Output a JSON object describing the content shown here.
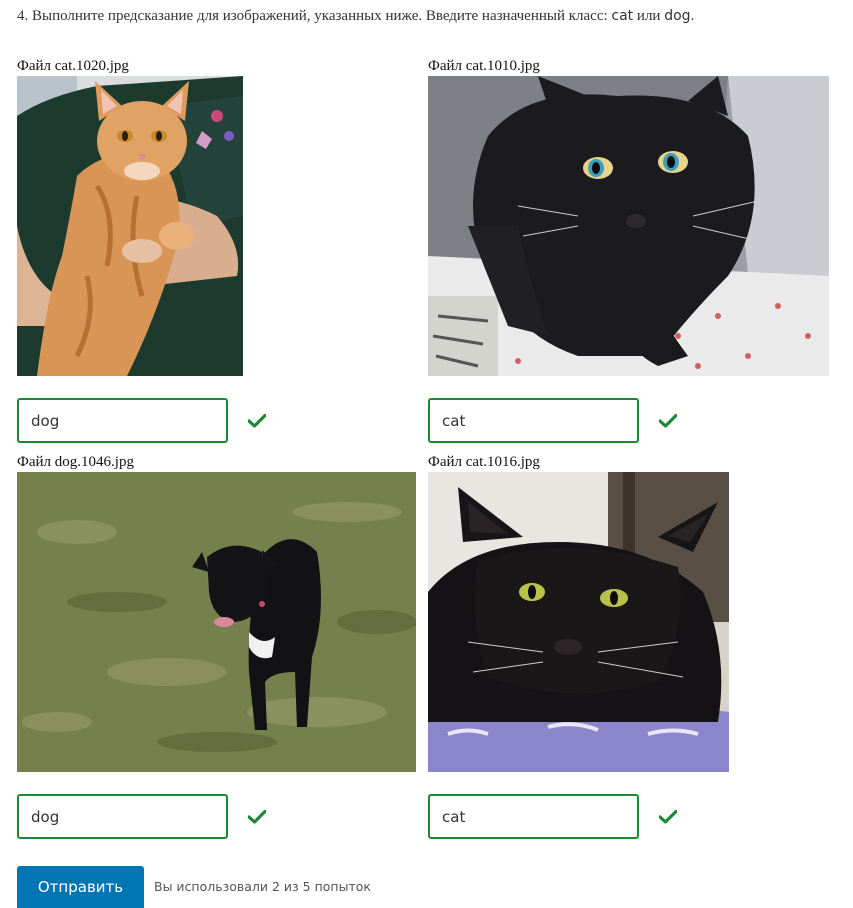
{
  "question": {
    "text_before": "4. Выполните предсказание для изображений, указанных ниже. Введите назначенный класс: ",
    "class_a": "cat",
    "separator": " или ",
    "class_b": "dog",
    "text_after": "."
  },
  "items": [
    {
      "file_label": "Файл cat.1020.jpg",
      "answer": "dog",
      "status": "correct",
      "image": "orange-tabby-cat-held-by-person"
    },
    {
      "file_label": "Файл cat.1010.jpg",
      "answer": "cat",
      "status": "correct",
      "image": "black-cat-in-cage"
    },
    {
      "file_label": "Файл dog.1046.jpg",
      "answer": "dog",
      "status": "correct",
      "image": "black-puppy-on-grass"
    },
    {
      "file_label": "Файл cat.1016.jpg",
      "answer": "cat",
      "status": "correct",
      "image": "black-cat-on-blanket"
    }
  ],
  "submit": {
    "label": "Отправить"
  },
  "attempts_text": "Вы использовали 2 из 5 попыток",
  "colors": {
    "accent": "#0075b4",
    "correct": "#1c8a32"
  }
}
